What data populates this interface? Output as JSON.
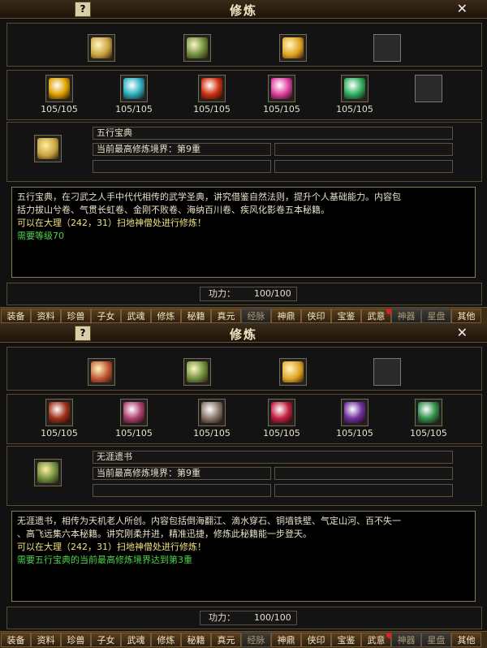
{
  "panels": [
    {
      "title": "修炼",
      "help_icon": "?",
      "close_icon": "✕",
      "top_slots": [
        {
          "icon": "book-yellow-icon",
          "color": "#c8a040"
        },
        {
          "icon": "scroll-chest-icon",
          "color": "#6a8a3a"
        },
        {
          "icon": "treasure-book-icon",
          "color": "#e0a020"
        },
        {
          "icon": "empty-slot",
          "color": ""
        }
      ],
      "item_slots": [
        {
          "icon": "yellow-book-icon",
          "color": "#e0a000",
          "qty": "105/105"
        },
        {
          "icon": "cyan-book-icon",
          "color": "#2ab0c0",
          "qty": "105/105"
        },
        {
          "icon": "red-book-icon",
          "color": "#d03010",
          "qty": "105/105"
        },
        {
          "icon": "pink-book-icon",
          "color": "#e040a0",
          "qty": "105/105"
        },
        {
          "icon": "green-book-icon",
          "color": "#30b060",
          "qty": "105/105"
        },
        {
          "icon": "empty-slot",
          "color": ""
        }
      ],
      "selected_icon": "book-icon",
      "selected_color": "#c8a040",
      "book_name": "五行宝典",
      "realm": "当前最高修炼境界：第9重",
      "desc_lines": [
        "五行宝典，在刁武之人手中代代相传的武学圣典，讲究借鉴自然法则，提升个人基础能力。内容包",
        "括力拔山兮卷、气贯长虹卷、金刚不败卷、海纳百川卷、疾风化影卷五本秘籍。"
      ],
      "location_line": "可以在大理（242，31）扫地神僧处进行修炼！",
      "requirement": "需要等级70",
      "power_label": "功力：",
      "power_value": "100/100"
    },
    {
      "title": "修炼",
      "help_icon": "?",
      "close_icon": "✕",
      "top_slots": [
        {
          "icon": "book-yellow-icon",
          "color": "#c05030"
        },
        {
          "icon": "scroll-chest-icon",
          "color": "#6a8a3a"
        },
        {
          "icon": "treasure-book-icon",
          "color": "#e0a020"
        },
        {
          "icon": "empty-slot",
          "color": ""
        }
      ],
      "item_slots": [
        {
          "icon": "red-scroll-icon",
          "color": "#a03018",
          "qty": "105/105"
        },
        {
          "icon": "pink-scroll-icon",
          "color": "#b04070",
          "qty": "105/105"
        },
        {
          "icon": "grey-scroll-icon",
          "color": "#8a7a6a",
          "qty": "105/105"
        },
        {
          "icon": "crimson-scroll-icon",
          "color": "#c02040",
          "qty": "105/105"
        },
        {
          "icon": "purple-scroll-icon",
          "color": "#7030a0",
          "qty": "105/105"
        },
        {
          "icon": "green-scroll-icon",
          "color": "#30904a",
          "qty": "105/105"
        }
      ],
      "selected_icon": "scroll-chest-icon",
      "selected_color": "#6a8a3a",
      "book_name": "无涯遗书",
      "realm": "当前最高修炼境界：第9重",
      "desc_lines": [
        "无涯遗书，相传为天机老人所创。内容包括倒海翻江、滴水穿石、铜墙铁壁、气定山河、百不失一",
        "、高飞远集六本秘籍。讲究刚柔并进，精准迅捷，修炼此秘籍能一步登天。"
      ],
      "location_line": "可以在大理（242，31）扫地神僧处进行修炼！",
      "requirement": "需要五行宝典的当前最高修炼境界达到第3重",
      "power_label": "功力：",
      "power_value": "100/100"
    }
  ],
  "tabs": [
    {
      "label": "装备",
      "dim": false,
      "dot": false
    },
    {
      "label": "资料",
      "dim": false,
      "dot": false
    },
    {
      "label": "珍兽",
      "dim": false,
      "dot": false
    },
    {
      "label": "子女",
      "dim": false,
      "dot": false
    },
    {
      "label": "武魂",
      "dim": false,
      "dot": false
    },
    {
      "label": "修炼",
      "dim": false,
      "dot": false
    },
    {
      "label": "秘籍",
      "dim": false,
      "dot": false
    },
    {
      "label": "真元",
      "dim": false,
      "dot": false
    },
    {
      "label": "经脉",
      "dim": true,
      "dot": false
    },
    {
      "label": "神鼎",
      "dim": false,
      "dot": false
    },
    {
      "label": "侠印",
      "dim": false,
      "dot": false
    },
    {
      "label": "宝鉴",
      "dim": false,
      "dot": false
    },
    {
      "label": "武意",
      "dim": false,
      "dot": true
    },
    {
      "label": "神器",
      "dim": true,
      "dot": false
    },
    {
      "label": "星盘",
      "dim": true,
      "dot": false
    },
    {
      "label": "其他",
      "dim": false,
      "dot": false
    }
  ]
}
